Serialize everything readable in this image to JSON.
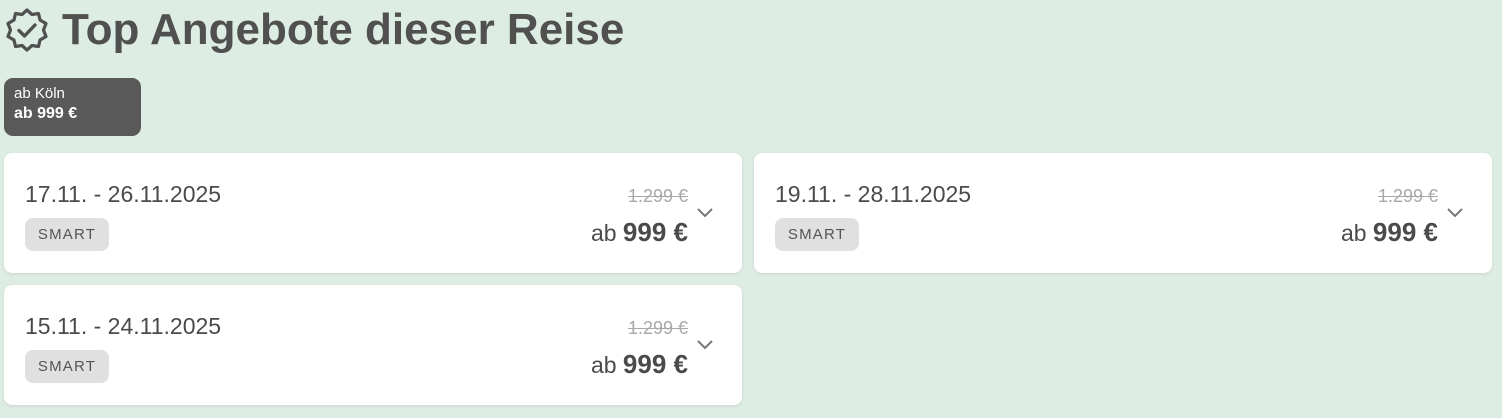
{
  "header": {
    "title": "Top Angebote dieser Reise",
    "icon": "verified-badge-icon"
  },
  "origin_filter": {
    "origin": "ab Köln",
    "price": "ab 999 €"
  },
  "offers": [
    {
      "dates": "17.11. - 26.11.2025",
      "tag": "SMART",
      "old_price": "1.299 €",
      "price_prefix": "ab",
      "price": "999 €"
    },
    {
      "dates": "19.11. - 28.11.2025",
      "tag": "SMART",
      "old_price": "1.299 €",
      "price_prefix": "ab",
      "price": "999 €"
    },
    {
      "dates": "15.11. - 24.11.2025",
      "tag": "SMART",
      "old_price": "1.299 €",
      "price_prefix": "ab",
      "price": "999 €"
    }
  ],
  "colors": {
    "background": "#deede4",
    "chip_background": "#595959",
    "card_background": "#ffffff",
    "tag_background": "#e0e0e0"
  }
}
